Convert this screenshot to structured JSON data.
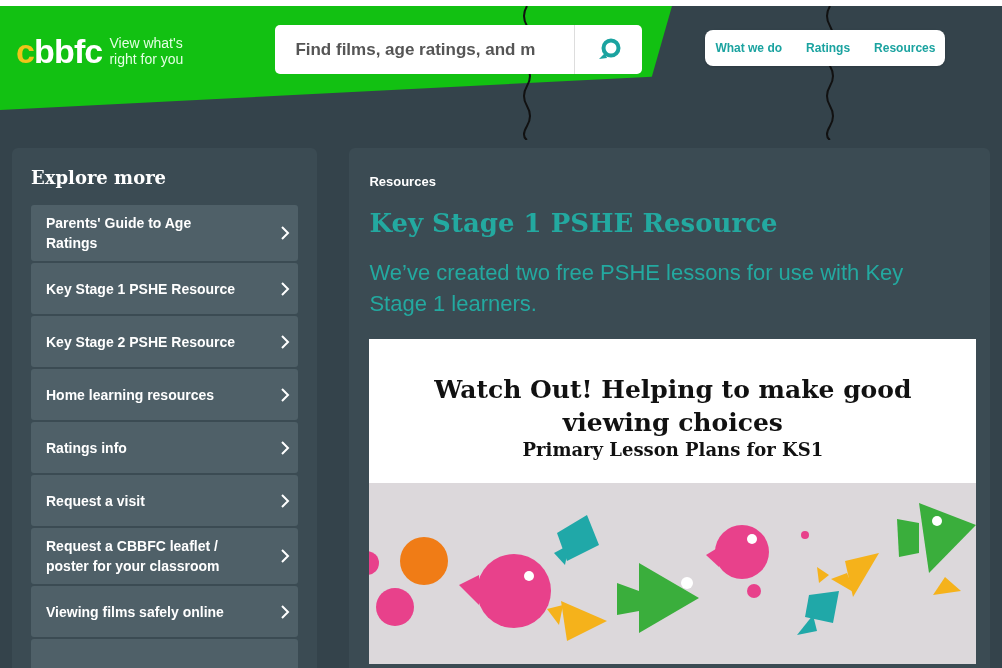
{
  "logo": {
    "wordmark": "cbbfc",
    "tagline": [
      "View what's",
      "right for you"
    ]
  },
  "search": {
    "placeholder": "Find films, age ratings, and m"
  },
  "nav": [
    "What we do",
    "Ratings",
    "Resources"
  ],
  "sidebar": {
    "title": "Explore more",
    "items": [
      {
        "label": "Parents' Guide to Age Ratings"
      },
      {
        "label": "Key Stage 1 PSHE Resource"
      },
      {
        "label": "Key Stage 2 PSHE Resource"
      },
      {
        "label": "Home learning resources"
      },
      {
        "label": "Ratings info"
      },
      {
        "label": "Request a visit"
      },
      {
        "label": "Request a CBBFC leaflet / poster for your classroom"
      },
      {
        "label": "Viewing films safely online"
      }
    ]
  },
  "main": {
    "breadcrumb": "Resources",
    "title": "Key Stage 1 PSHE Resource",
    "intro": "We’ve created two free PSHE lessons for use with Key Stage 1 learners.",
    "poster": {
      "title": "Watch Out! Helping to make good viewing choices",
      "subtitle": "Primary Lesson Plans for KS1"
    }
  }
}
